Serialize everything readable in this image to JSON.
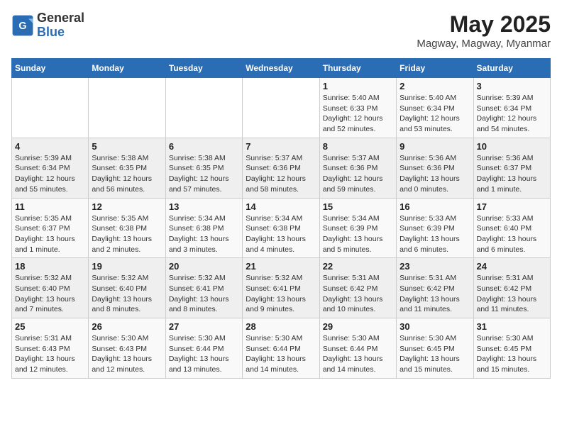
{
  "header": {
    "logo_general": "General",
    "logo_blue": "Blue",
    "month_year": "May 2025",
    "location": "Magway, Magway, Myanmar"
  },
  "weekdays": [
    "Sunday",
    "Monday",
    "Tuesday",
    "Wednesday",
    "Thursday",
    "Friday",
    "Saturday"
  ],
  "weeks": [
    [
      {
        "day": "",
        "detail": ""
      },
      {
        "day": "",
        "detail": ""
      },
      {
        "day": "",
        "detail": ""
      },
      {
        "day": "",
        "detail": ""
      },
      {
        "day": "1",
        "detail": "Sunrise: 5:40 AM\nSunset: 6:33 PM\nDaylight: 12 hours\nand 52 minutes."
      },
      {
        "day": "2",
        "detail": "Sunrise: 5:40 AM\nSunset: 6:34 PM\nDaylight: 12 hours\nand 53 minutes."
      },
      {
        "day": "3",
        "detail": "Sunrise: 5:39 AM\nSunset: 6:34 PM\nDaylight: 12 hours\nand 54 minutes."
      }
    ],
    [
      {
        "day": "4",
        "detail": "Sunrise: 5:39 AM\nSunset: 6:34 PM\nDaylight: 12 hours\nand 55 minutes."
      },
      {
        "day": "5",
        "detail": "Sunrise: 5:38 AM\nSunset: 6:35 PM\nDaylight: 12 hours\nand 56 minutes."
      },
      {
        "day": "6",
        "detail": "Sunrise: 5:38 AM\nSunset: 6:35 PM\nDaylight: 12 hours\nand 57 minutes."
      },
      {
        "day": "7",
        "detail": "Sunrise: 5:37 AM\nSunset: 6:36 PM\nDaylight: 12 hours\nand 58 minutes."
      },
      {
        "day": "8",
        "detail": "Sunrise: 5:37 AM\nSunset: 6:36 PM\nDaylight: 12 hours\nand 59 minutes."
      },
      {
        "day": "9",
        "detail": "Sunrise: 5:36 AM\nSunset: 6:36 PM\nDaylight: 13 hours\nand 0 minutes."
      },
      {
        "day": "10",
        "detail": "Sunrise: 5:36 AM\nSunset: 6:37 PM\nDaylight: 13 hours\nand 1 minute."
      }
    ],
    [
      {
        "day": "11",
        "detail": "Sunrise: 5:35 AM\nSunset: 6:37 PM\nDaylight: 13 hours\nand 1 minute."
      },
      {
        "day": "12",
        "detail": "Sunrise: 5:35 AM\nSunset: 6:38 PM\nDaylight: 13 hours\nand 2 minutes."
      },
      {
        "day": "13",
        "detail": "Sunrise: 5:34 AM\nSunset: 6:38 PM\nDaylight: 13 hours\nand 3 minutes."
      },
      {
        "day": "14",
        "detail": "Sunrise: 5:34 AM\nSunset: 6:38 PM\nDaylight: 13 hours\nand 4 minutes."
      },
      {
        "day": "15",
        "detail": "Sunrise: 5:34 AM\nSunset: 6:39 PM\nDaylight: 13 hours\nand 5 minutes."
      },
      {
        "day": "16",
        "detail": "Sunrise: 5:33 AM\nSunset: 6:39 PM\nDaylight: 13 hours\nand 6 minutes."
      },
      {
        "day": "17",
        "detail": "Sunrise: 5:33 AM\nSunset: 6:40 PM\nDaylight: 13 hours\nand 6 minutes."
      }
    ],
    [
      {
        "day": "18",
        "detail": "Sunrise: 5:32 AM\nSunset: 6:40 PM\nDaylight: 13 hours\nand 7 minutes."
      },
      {
        "day": "19",
        "detail": "Sunrise: 5:32 AM\nSunset: 6:40 PM\nDaylight: 13 hours\nand 8 minutes."
      },
      {
        "day": "20",
        "detail": "Sunrise: 5:32 AM\nSunset: 6:41 PM\nDaylight: 13 hours\nand 8 minutes."
      },
      {
        "day": "21",
        "detail": "Sunrise: 5:32 AM\nSunset: 6:41 PM\nDaylight: 13 hours\nand 9 minutes."
      },
      {
        "day": "22",
        "detail": "Sunrise: 5:31 AM\nSunset: 6:42 PM\nDaylight: 13 hours\nand 10 minutes."
      },
      {
        "day": "23",
        "detail": "Sunrise: 5:31 AM\nSunset: 6:42 PM\nDaylight: 13 hours\nand 11 minutes."
      },
      {
        "day": "24",
        "detail": "Sunrise: 5:31 AM\nSunset: 6:42 PM\nDaylight: 13 hours\nand 11 minutes."
      }
    ],
    [
      {
        "day": "25",
        "detail": "Sunrise: 5:31 AM\nSunset: 6:43 PM\nDaylight: 13 hours\nand 12 minutes."
      },
      {
        "day": "26",
        "detail": "Sunrise: 5:30 AM\nSunset: 6:43 PM\nDaylight: 13 hours\nand 12 minutes."
      },
      {
        "day": "27",
        "detail": "Sunrise: 5:30 AM\nSunset: 6:44 PM\nDaylight: 13 hours\nand 13 minutes."
      },
      {
        "day": "28",
        "detail": "Sunrise: 5:30 AM\nSunset: 6:44 PM\nDaylight: 13 hours\nand 14 minutes."
      },
      {
        "day": "29",
        "detail": "Sunrise: 5:30 AM\nSunset: 6:44 PM\nDaylight: 13 hours\nand 14 minutes."
      },
      {
        "day": "30",
        "detail": "Sunrise: 5:30 AM\nSunset: 6:45 PM\nDaylight: 13 hours\nand 15 minutes."
      },
      {
        "day": "31",
        "detail": "Sunrise: 5:30 AM\nSunset: 6:45 PM\nDaylight: 13 hours\nand 15 minutes."
      }
    ]
  ]
}
